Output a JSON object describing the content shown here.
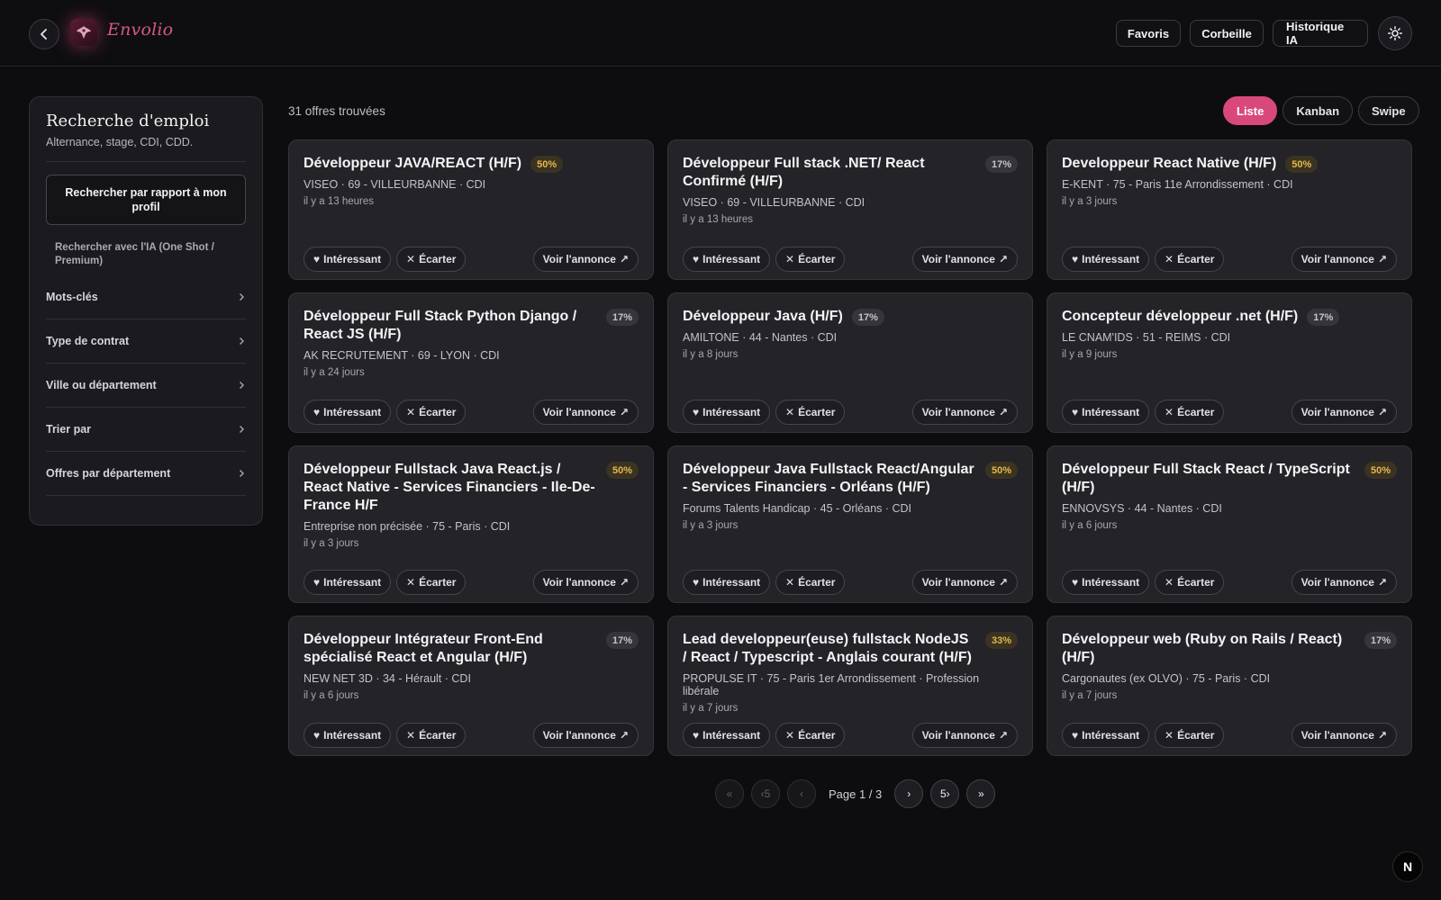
{
  "header": {
    "brand": "Envolio",
    "buttons": {
      "favoris": "Favoris",
      "corbeille": "Corbeille",
      "historique": "Historique IA"
    }
  },
  "sidebar": {
    "title": "Recherche d'emploi",
    "subtitle": "Alternance, stage, CDI, CDD.",
    "profile_button": "Rechercher par rapport à mon profil",
    "ia_link": "Rechercher avec l'IA (One Shot / Premium)",
    "sections": [
      "Mots-clés",
      "Type de contrat",
      "Ville ou département",
      "Trier par",
      "Offres par département"
    ]
  },
  "results": {
    "count_label": "31 offres trouvées",
    "views": [
      "Liste",
      "Kanban",
      "Swipe"
    ],
    "active_view": "Liste"
  },
  "card_actions": {
    "interested": "Intéressant",
    "discard": "Écarter",
    "view": "Voir l'annonce"
  },
  "jobs": [
    {
      "title": "Développeur JAVA/REACT (H/F)",
      "score": "50%",
      "meta": "VISEO · 69 - VILLEURBANNE · CDI",
      "time": "il y a 13 heures"
    },
    {
      "title": "Développeur Full stack .NET/ React Confirmé (H/F)",
      "score": "17%",
      "meta": "VISEO · 69 - VILLEURBANNE · CDI",
      "time": "il y a 13 heures"
    },
    {
      "title": "Developpeur React Native (H/F)",
      "score": "50%",
      "meta": "E-KENT · 75 - Paris 11e Arrondissement · CDI",
      "time": "il y a 3 jours"
    },
    {
      "title": "Développeur Full Stack Python Django / React JS (H/F)",
      "score": "17%",
      "meta": "AK RECRUTEMENT · 69 - LYON · CDI",
      "time": "il y a 24 jours"
    },
    {
      "title": "Développeur Java (H/F)",
      "score": "17%",
      "meta": "AMILTONE · 44 - Nantes · CDI",
      "time": "il y a 8 jours"
    },
    {
      "title": "Concepteur développeur .net (H/F)",
      "score": "17%",
      "meta": "LE CNAM'IDS · 51 - REIMS · CDI",
      "time": "il y a 9 jours"
    },
    {
      "title": "Développeur Fullstack Java React.js / React Native - Services Financiers - Ile-De-France H/F",
      "score": "50%",
      "meta": "Entreprise non précisée · 75 - Paris · CDI",
      "time": "il y a 3 jours"
    },
    {
      "title": "Développeur Java Fullstack React/Angular - Services Financiers - Orléans (H/F)",
      "score": "50%",
      "meta": "Forums Talents Handicap · 45 - Orléans · CDI",
      "time": "il y a 3 jours"
    },
    {
      "title": "Développeur Full Stack React / TypeScript (H/F)",
      "score": "50%",
      "meta": "ENNOVSYS · 44 - Nantes · CDI",
      "time": "il y a 6 jours"
    },
    {
      "title": "Développeur Intégrateur Front-End spécialisé React et Angular (H/F)",
      "score": "17%",
      "meta": "NEW NET 3D · 34 - Hérault · CDI",
      "time": "il y a 6 jours"
    },
    {
      "title": "Lead developpeur(euse) fullstack NodeJS / React / Typescript - Anglais courant (H/F)",
      "score": "33%",
      "meta": "PROPULSE IT · 75 - Paris 1er Arrondissement · Profession libérale",
      "time": "il y a 7 jours"
    },
    {
      "title": "Développeur web (Ruby on Rails / React) (H/F)",
      "score": "17%",
      "meta": "Cargonautes (ex OLVO) · 75 - Paris · CDI",
      "time": "il y a 7 jours"
    }
  ],
  "pagination": {
    "first": "«",
    "back5": "‹5",
    "prev": "‹",
    "label": "Page 1 / 3",
    "next": "›",
    "fwd5": "5›",
    "last": "»"
  },
  "corner_badge": "N",
  "colors": {
    "accent": "#d9487a",
    "high_score": "#e6b84a",
    "background": "#0d0d10"
  }
}
